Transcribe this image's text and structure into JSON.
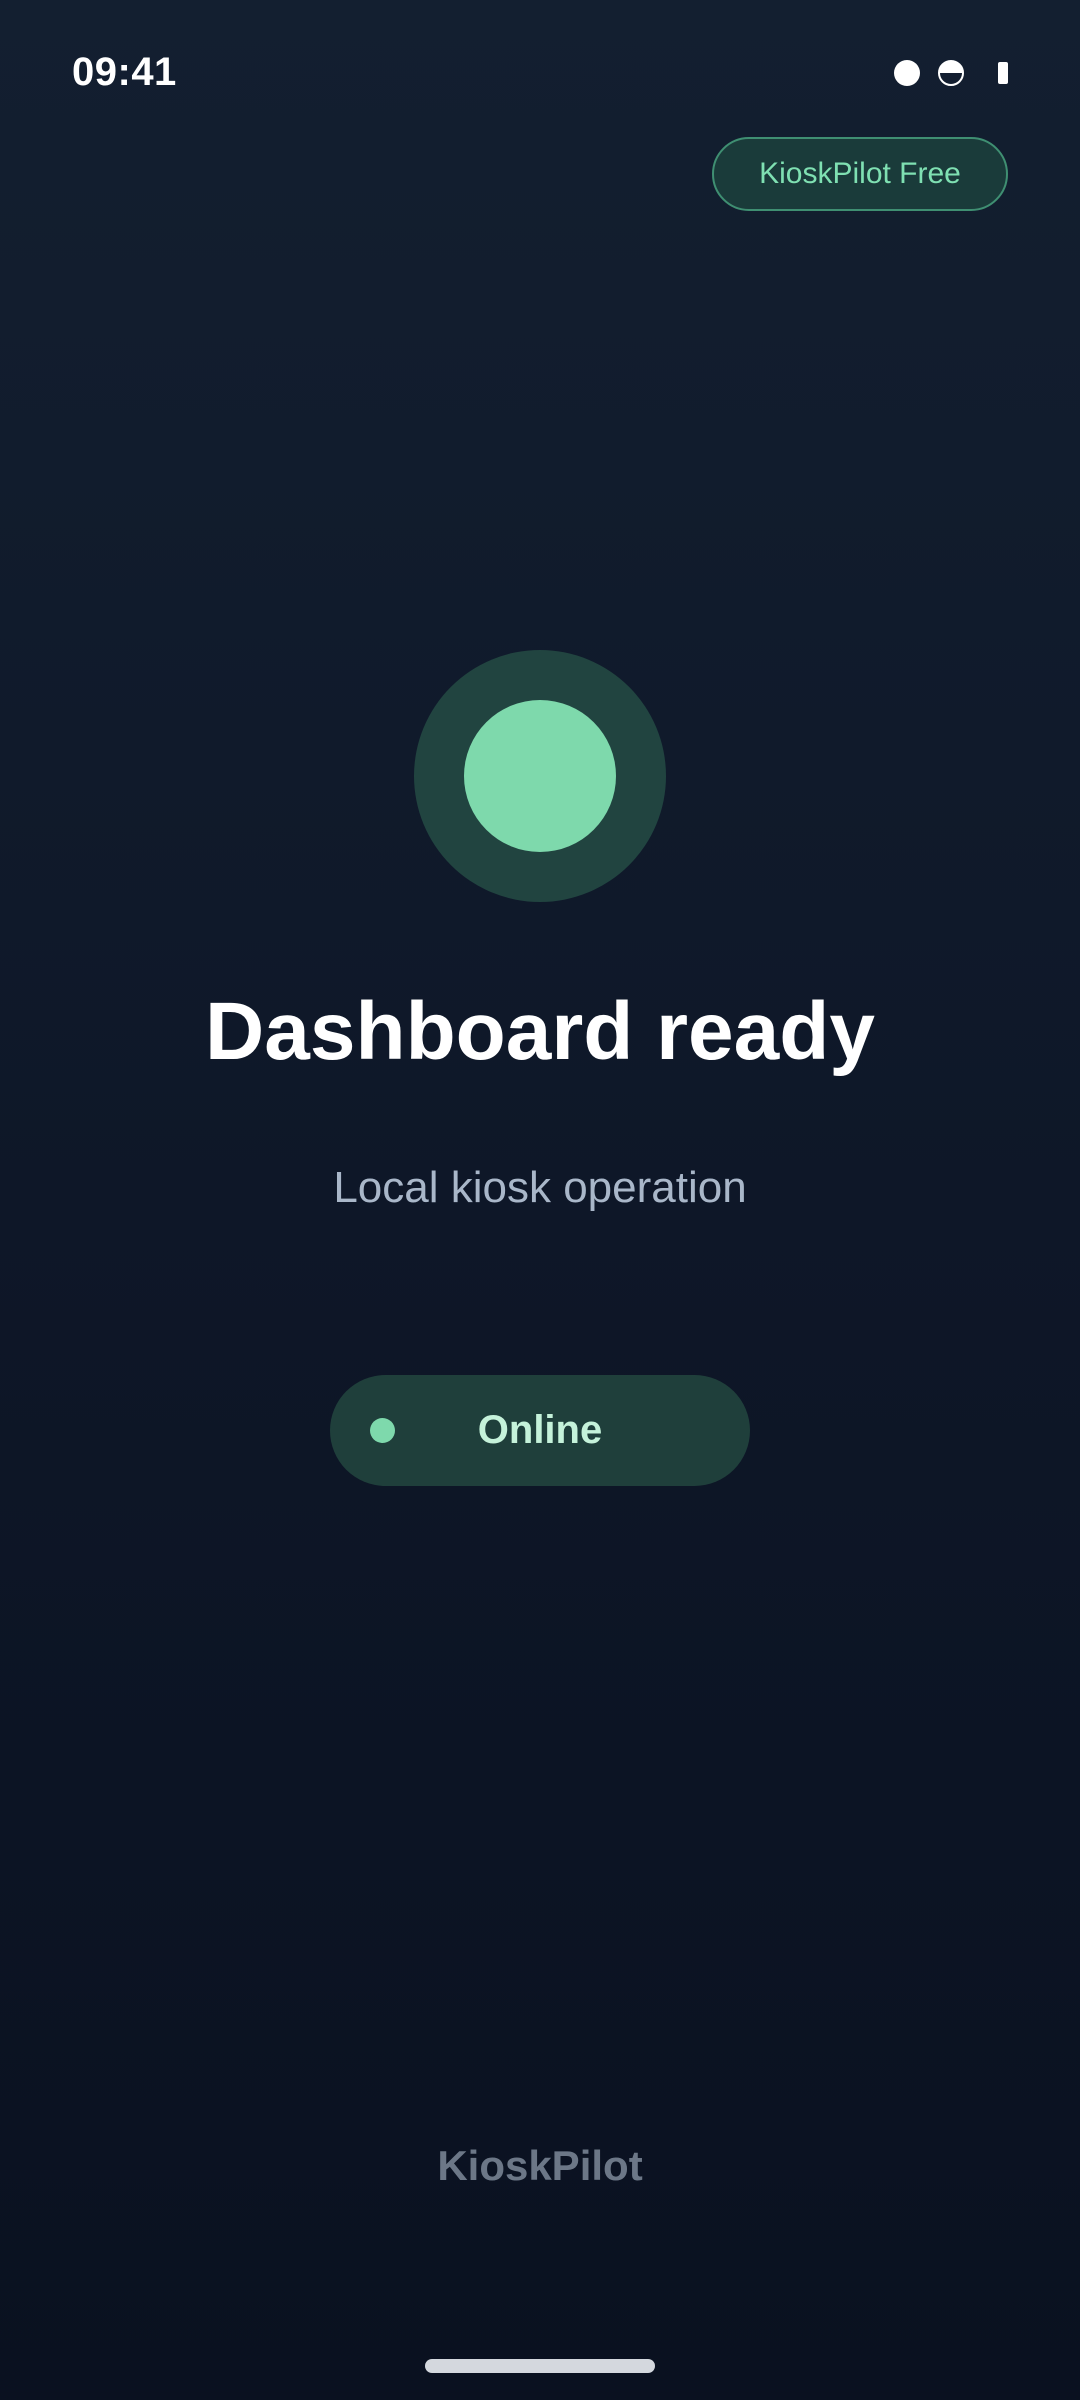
{
  "status_bar": {
    "time": "09:41",
    "icons": [
      "signal-dot-icon",
      "half-circle-icon",
      "battery-icon"
    ]
  },
  "plan_badge": {
    "label": "KioskPilot Free"
  },
  "hero": {
    "status_indicator_icon": "status-circle-icon",
    "title": "Dashboard ready",
    "subtitle": "Local kiosk operation"
  },
  "connection": {
    "label": "Online",
    "dot_icon": "online-dot-icon"
  },
  "footer": {
    "brand": "KioskPilot"
  },
  "colors": {
    "background": "#0e1728",
    "accent": "#7ed9ac",
    "accent_dark": "#1f3f3b",
    "badge_text": "#7fe0b2",
    "subtitle": "#a9b7c9",
    "footer_text": "#6c7787"
  }
}
